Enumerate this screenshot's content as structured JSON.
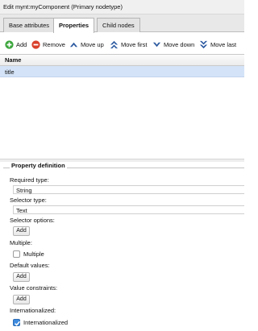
{
  "window": {
    "title": "Edit mynt:myComponent (Primary nodetype)"
  },
  "tabs": [
    {
      "label": "Base attributes",
      "active": false
    },
    {
      "label": "Properties",
      "active": true
    },
    {
      "label": "Child nodes",
      "active": false
    }
  ],
  "toolbar": {
    "add_label": "Add",
    "remove_label": "Remove",
    "move_up_label": "Move up",
    "move_first_label": "Move first",
    "move_down_label": "Move down",
    "move_last_label": "Move last"
  },
  "grid": {
    "header": "Name",
    "rows": [
      {
        "name": "title",
        "selected": true
      }
    ]
  },
  "property_definition": {
    "legend": "Property definition",
    "required_type_label": "Required type:",
    "required_type_value": "String",
    "selector_type_label": "Selector type:",
    "selector_type_value": "Text",
    "selector_options_label": "Selector options:",
    "selector_options_add": "Add",
    "multiple_label": "Multiple:",
    "multiple_checkbox_label": "Multiple",
    "multiple_checked": false,
    "default_values_label": "Default values:",
    "default_values_add": "Add",
    "value_constraints_label": "Value constraints:",
    "value_constraints_add": "Add",
    "internationalized_label": "Internationalized:",
    "internationalized_checkbox_label": "Internationalized",
    "internationalized_checked": true
  },
  "colors": {
    "add_icon": "#3aa53a",
    "remove_icon": "#d9402b",
    "move_icons": "#2c5aa0",
    "selected_row": "#d4e3f7"
  }
}
